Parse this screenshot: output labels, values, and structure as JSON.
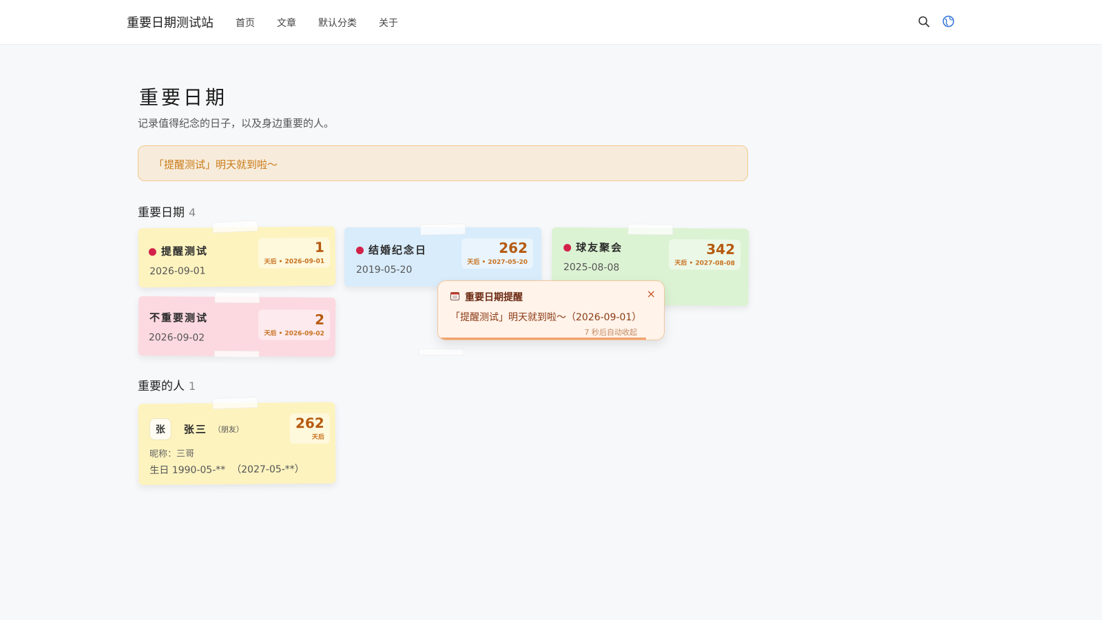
{
  "header": {
    "site_title": "重要日期测试站",
    "nav": [
      "首页",
      "文章",
      "默认分类",
      "关于"
    ]
  },
  "page": {
    "title": "重要日期",
    "subtitle": "记录值得纪念的日子，以及身边重要的人。"
  },
  "alert": {
    "text": "「提醒测试」明天就到啦～"
  },
  "sections": {
    "dates": {
      "label": "重要日期",
      "count": "4"
    },
    "people": {
      "label": "重要的人",
      "count": "1"
    }
  },
  "date_cards": [
    {
      "title": "提醒测试",
      "date": "2026-09-01",
      "days": "1",
      "sub": "天后 • 2026-09-01",
      "color": "#fdf3bf"
    },
    {
      "title": "结婚纪念日",
      "date": "2019-05-20",
      "days": "262",
      "sub": "天后 • 2027-05-20",
      "color": "#d8ecfb"
    },
    {
      "title": "球友聚会",
      "date": "2025-08-08",
      "days": "342",
      "sub": "天后 • 2027-08-08",
      "color": "#dcf3d3"
    },
    {
      "title": "不重要测试",
      "date": "2026-09-02",
      "days": "2",
      "sub": "天后 • 2026-09-02",
      "color": "#fcd9e0"
    }
  ],
  "person_card": {
    "avatar": "张",
    "name": "张三",
    "relation": "（朋友）",
    "days": "262",
    "sub": "天后",
    "nickname": "昵称：三哥",
    "birthday": "生日 1990-05-**  （2027-05-**）",
    "color": "#fdf3bf"
  },
  "popup": {
    "title": "重要日期提醒",
    "message": "「提醒测试」明天就到啦～（2026-09-01）",
    "auto_close": "7 秒后自动收起",
    "progress": 0.92
  },
  "colors": {
    "accent": "#d3224a",
    "warning": "#c97a16"
  }
}
